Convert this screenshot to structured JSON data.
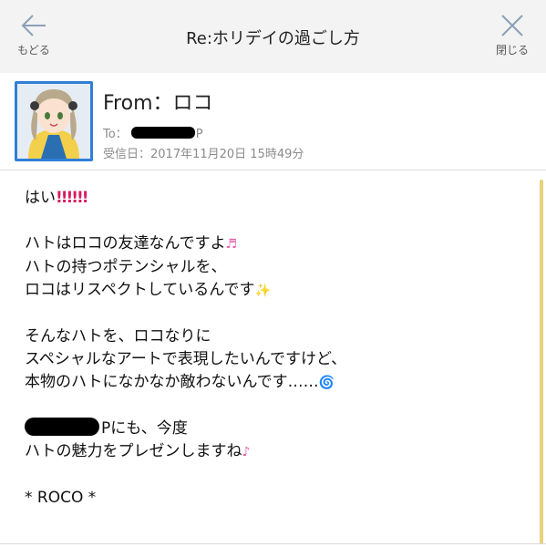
{
  "nav": {
    "back_label": "もどる",
    "title": "Re:ホリデイの過ごし方",
    "close_label": "閉じる"
  },
  "header": {
    "from": "From：ロコ",
    "to_prefix": "To：",
    "to_suffix": "P",
    "received": "受信日：2017年11月20日 15時49分"
  },
  "body": {
    "l1": "はい",
    "l1_marks": "!!!!!!",
    "l2": "ハトはロコの友達なんですよ",
    "l2_emoji": "♬",
    "l3": "ハトの持つポテンシャルを、",
    "l4": "ロコはリスペクトしているんです",
    "l4_emoji": "✨",
    "l5": "そんなハトを、ロコなりに",
    "l6": "スペシャルなアートで表現したいんですけど、",
    "l7": "本物のハトになかなか敵わないんです……",
    "l7_emoji": "🌀",
    "l8": "Pにも、今度",
    "l9": "ハトの魅力をプレゼンしますね",
    "l9_emoji": "♪",
    "sign": "* ROCO *"
  },
  "colors": {
    "accent": "#2f7fd6",
    "topbar": "#f3f3f3",
    "emphasis": "#d81b60",
    "scrollbar": "#e9d27a"
  },
  "icons": {
    "back": "arrow-left-icon",
    "close": "close-x-icon"
  }
}
